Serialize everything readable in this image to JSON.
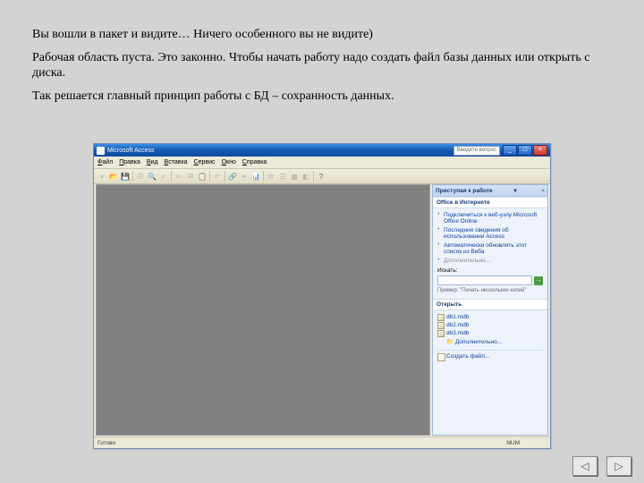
{
  "paragraphs": {
    "p1": "Вы вошли в пакет и видите… Ничего особенного вы не видите)",
    "p2": "Рабочая область пуста. Это законно. Чтобы начать работу надо создать файл базы данных или открыть с диска.",
    "p3": "Так решается главный принцип работы с БД – сохранность данных."
  },
  "window": {
    "title": "Microsoft Access",
    "help_placeholder": "Введите вопрос"
  },
  "menu": {
    "file": "Файл",
    "edit": "Правка",
    "view": "Вид",
    "insert": "Вставка",
    "tools": "Сервис",
    "window": "Окно",
    "help": "Справка"
  },
  "taskpane": {
    "header": "Приступая к работе",
    "office_online": "Office в Интернете",
    "links": {
      "connect": "Подключиться к веб-узлу Microsoft Office Online",
      "news": "Последние сведения об использовании Access",
      "autoupdate": "Автоматически обновлять этот список из Веба",
      "more": "Дополнительно..."
    },
    "search_label": "Искать:",
    "example": "Пример: \"Печать нескольких копий\"",
    "open_header": "Открыть",
    "recent": [
      "db1.mdb",
      "db2.mdb",
      "db3.mdb"
    ],
    "open_more": "Дополнительно...",
    "create": "Создать файл..."
  },
  "statusbar": {
    "ready": "Готово",
    "num": "NUM"
  },
  "nav": {
    "prev": "◁",
    "next": "▷"
  }
}
